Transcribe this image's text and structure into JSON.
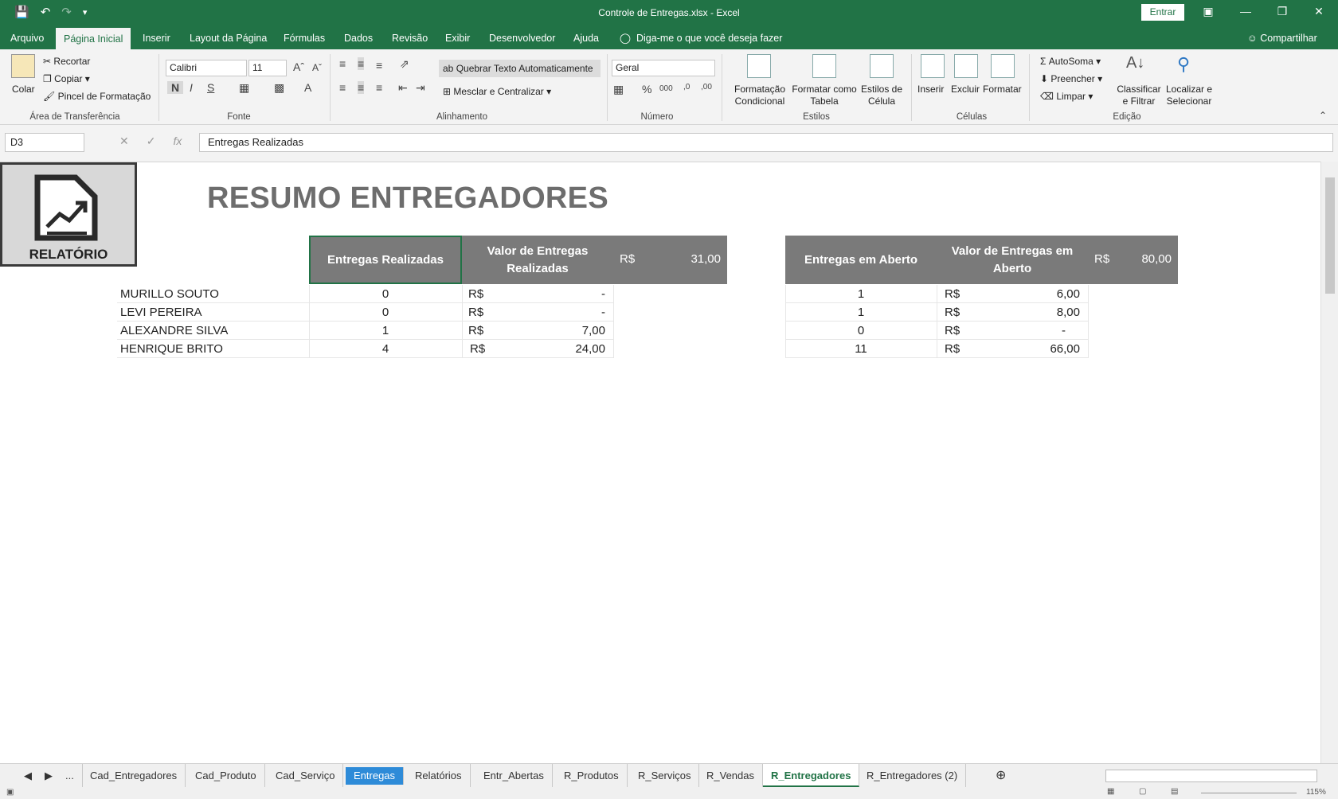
{
  "titlebar": {
    "title": "Controle de Entregas.xlsx  -  Excel",
    "signin": "Entrar"
  },
  "menu": {
    "tabs": [
      "Arquivo",
      "Página Inicial",
      "Inserir",
      "Layout da Página",
      "Fórmulas",
      "Dados",
      "Revisão",
      "Exibir",
      "Desenvolvedor",
      "Ajuda"
    ],
    "active": "Página Inicial",
    "tell_me": "Diga-me o que você deseja fazer",
    "share": "Compartilhar"
  },
  "ribbon": {
    "clipboard": {
      "paste": "Colar",
      "cut": "Recortar",
      "copy": "Copiar",
      "format_painter": "Pincel de Formatação",
      "label": "Área de Transferência"
    },
    "font": {
      "name": "Calibri",
      "size": "11",
      "bold": "N",
      "italic": "I",
      "underline": "S",
      "label": "Fonte"
    },
    "alignment": {
      "wrap": "Quebrar Texto Automaticamente",
      "merge": "Mesclar e Centralizar",
      "label": "Alinhamento"
    },
    "number": {
      "format": "Geral",
      "label": "Número"
    },
    "styles": {
      "conditional": [
        "Formatação",
        "Condicional"
      ],
      "as_table": [
        "Formatar como",
        "Tabela"
      ],
      "cell_styles": [
        "Estilos de",
        "Célula"
      ],
      "label": "Estilos"
    },
    "cells": {
      "insert": "Inserir",
      "delete": "Excluir",
      "format": "Formatar",
      "label": "Células"
    },
    "editing": {
      "autosum": "AutoSoma",
      "fill": "Preencher",
      "clear": "Limpar",
      "sort": [
        "Classificar",
        "e Filtrar"
      ],
      "find": [
        "Localizar e",
        "Selecionar"
      ],
      "label": "Edição"
    }
  },
  "formula_bar": {
    "name_box": "D3",
    "content": "Entregas Realizadas"
  },
  "sheet": {
    "logo_label": "RELATÓRIO",
    "title": "RESUMO ENTREGADORES",
    "left_table": {
      "headers": [
        "Entregas Realizadas",
        "Valor de Entregas Realizadas"
      ],
      "total_currency": "R$",
      "total_value": "31,00",
      "rows": [
        {
          "name": "MURILLO SOUTO",
          "count": "0",
          "currency": "R$",
          "value": "-"
        },
        {
          "name": "LEVI PEREIRA",
          "count": "0",
          "currency": "R$",
          "value": "-"
        },
        {
          "name": "ALEXANDRE SILVA",
          "count": "1",
          "currency": "R$",
          "value": "7,00"
        },
        {
          "name": "HENRIQUE BRITO",
          "count": "4",
          "currency": "R$",
          "value": "24,00"
        }
      ]
    },
    "right_table": {
      "headers": [
        "Entregas em Aberto",
        "Valor de Entregas em Aberto"
      ],
      "total_currency": "R$",
      "total_value": "80,00",
      "rows": [
        {
          "count": "1",
          "currency": "R$",
          "value": "6,00"
        },
        {
          "count": "1",
          "currency": "R$",
          "value": "8,00"
        },
        {
          "count": "0",
          "currency": "R$",
          "value": "-"
        },
        {
          "count": "11",
          "currency": "R$",
          "value": "66,00"
        }
      ]
    }
  },
  "sheet_tabs": {
    "ellipsis": "...",
    "tabs": [
      "Cad_Entregadores",
      "Cad_Produto",
      "Cad_Serviço",
      "Entregas",
      "Relatórios",
      "Entr_Abertas",
      "R_Produtos",
      "R_Serviços",
      "R_Vendas",
      "R_Entregadores",
      "R_Entregadores (2)"
    ],
    "active": "R_Entregadores",
    "colored": "Entregas",
    "colored_color": "#2e8bd8"
  },
  "status": {
    "zoom": "115%"
  },
  "colors": {
    "excel_green": "#217346",
    "header_gray": "#7a7a7a",
    "title_gray": "#6d6d6d"
  }
}
